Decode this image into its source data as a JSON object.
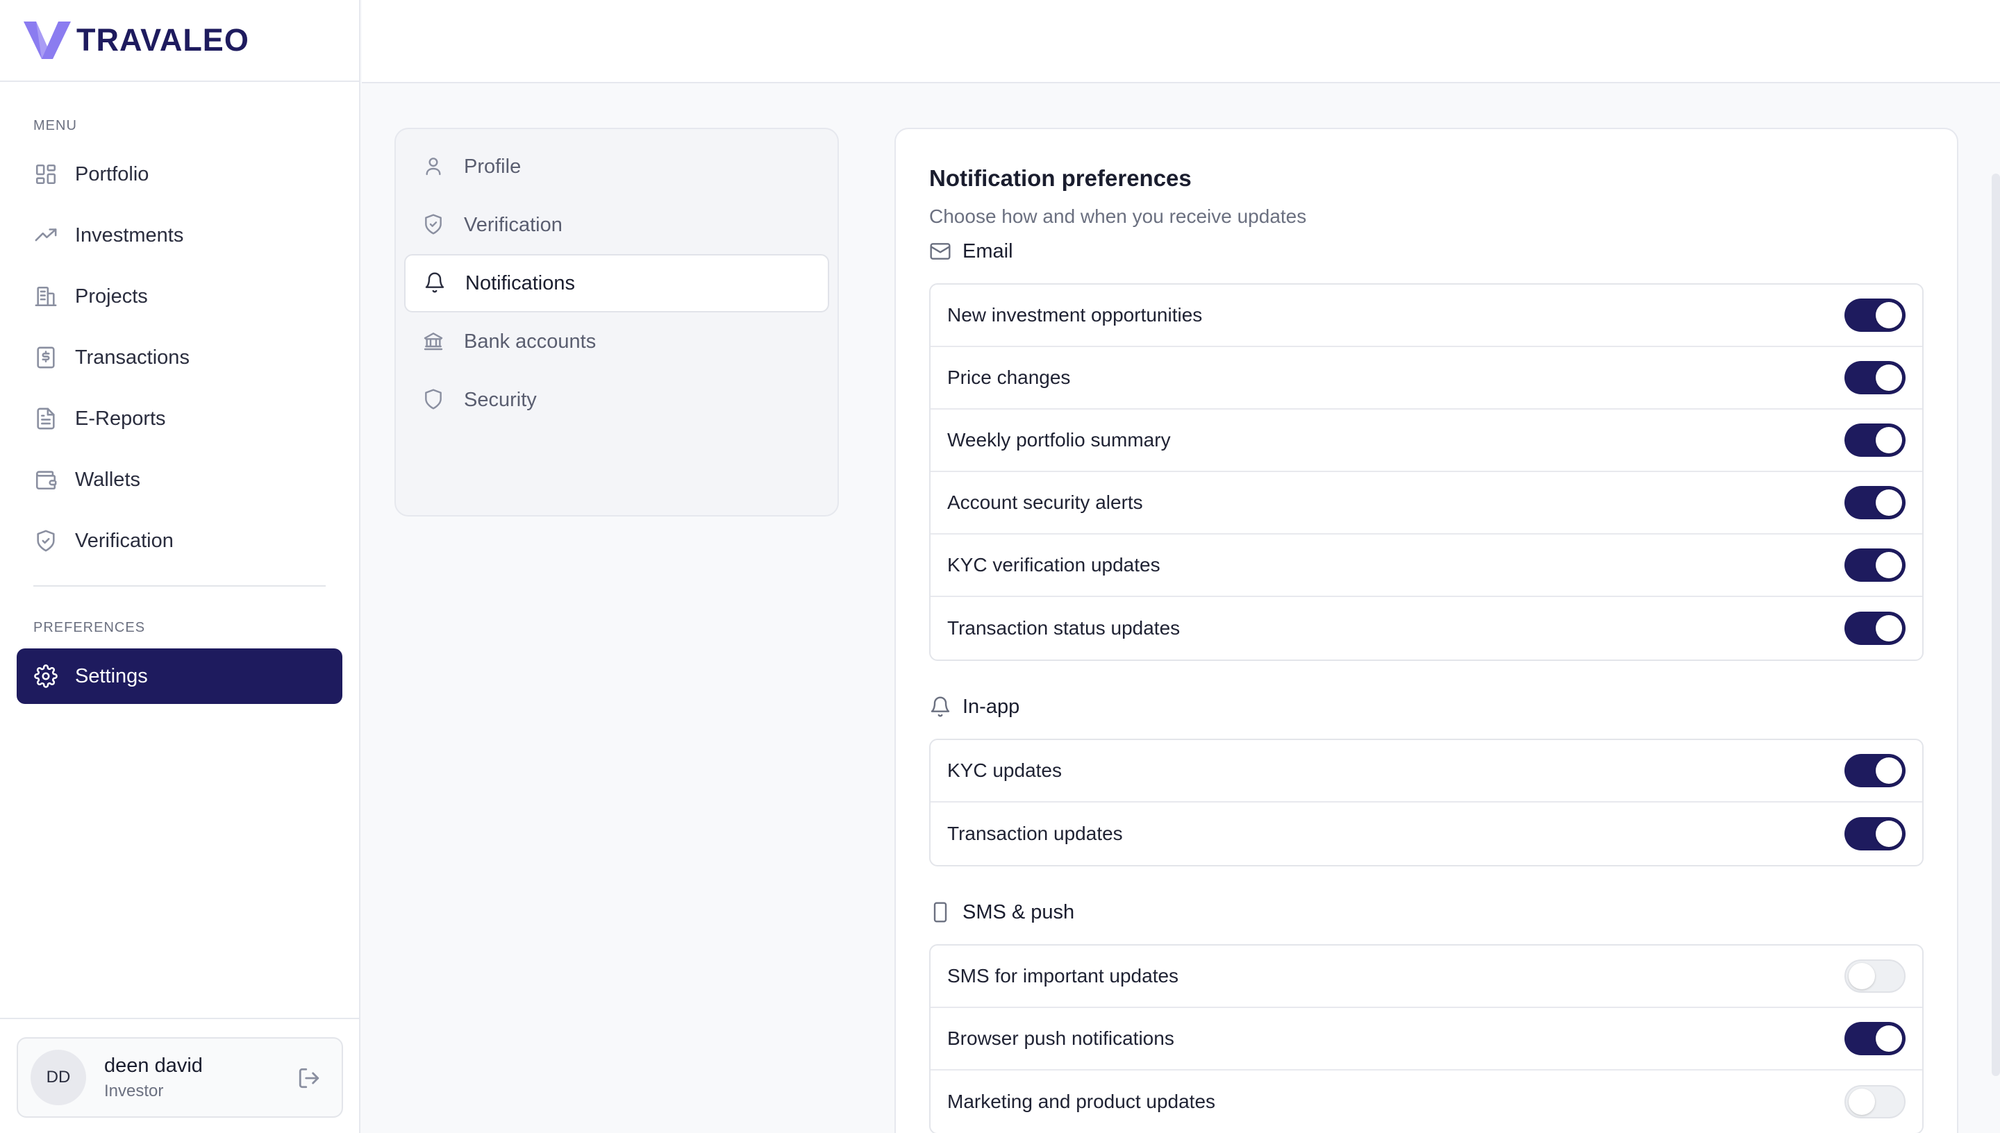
{
  "brand": {
    "name": "TRAVALEO",
    "logo_color": "#8b7cf0"
  },
  "sidebar": {
    "menu_label": "MENU",
    "items": [
      {
        "label": "Portfolio",
        "icon": "grid-icon"
      },
      {
        "label": "Investments",
        "icon": "trending-up-icon"
      },
      {
        "label": "Projects",
        "icon": "building-icon"
      },
      {
        "label": "Transactions",
        "icon": "dollar-receipt-icon"
      },
      {
        "label": "E-Reports",
        "icon": "file-text-icon"
      },
      {
        "label": "Wallets",
        "icon": "wallet-icon"
      },
      {
        "label": "Verification",
        "icon": "shield-check-icon"
      }
    ],
    "preferences_label": "PREFERENCES",
    "settings_label": "Settings",
    "active_color": "#1e1b5e"
  },
  "user": {
    "initials": "DD",
    "name": "deen david",
    "role": "Investor"
  },
  "subnav": {
    "items": [
      {
        "label": "Profile",
        "icon": "user-icon"
      },
      {
        "label": "Verification",
        "icon": "shield-check-icon"
      },
      {
        "label": "Notifications",
        "icon": "bell-icon",
        "active": true
      },
      {
        "label": "Bank accounts",
        "icon": "bank-icon"
      },
      {
        "label": "Security",
        "icon": "shield-icon"
      }
    ]
  },
  "panel": {
    "title": "Notification preferences",
    "subtitle": "Choose how and when you receive updates",
    "groups": [
      {
        "title": "Email",
        "icon": "mail-icon",
        "rows": [
          {
            "label": "New investment opportunities",
            "on": true
          },
          {
            "label": "Price changes",
            "on": true
          },
          {
            "label": "Weekly portfolio summary",
            "on": true
          },
          {
            "label": "Account security alerts",
            "on": true
          },
          {
            "label": "KYC verification updates",
            "on": true
          },
          {
            "label": "Transaction status updates",
            "on": true
          }
        ]
      },
      {
        "title": "In-app",
        "icon": "bell-icon",
        "rows": [
          {
            "label": "KYC updates",
            "on": true
          },
          {
            "label": "Transaction updates",
            "on": true
          }
        ]
      },
      {
        "title": "SMS & push",
        "icon": "phone-icon",
        "rows": [
          {
            "label": "SMS for important updates",
            "on": false
          },
          {
            "label": "Browser push notifications",
            "on": true
          },
          {
            "label": "Marketing and product updates",
            "on": false
          }
        ]
      }
    ]
  }
}
